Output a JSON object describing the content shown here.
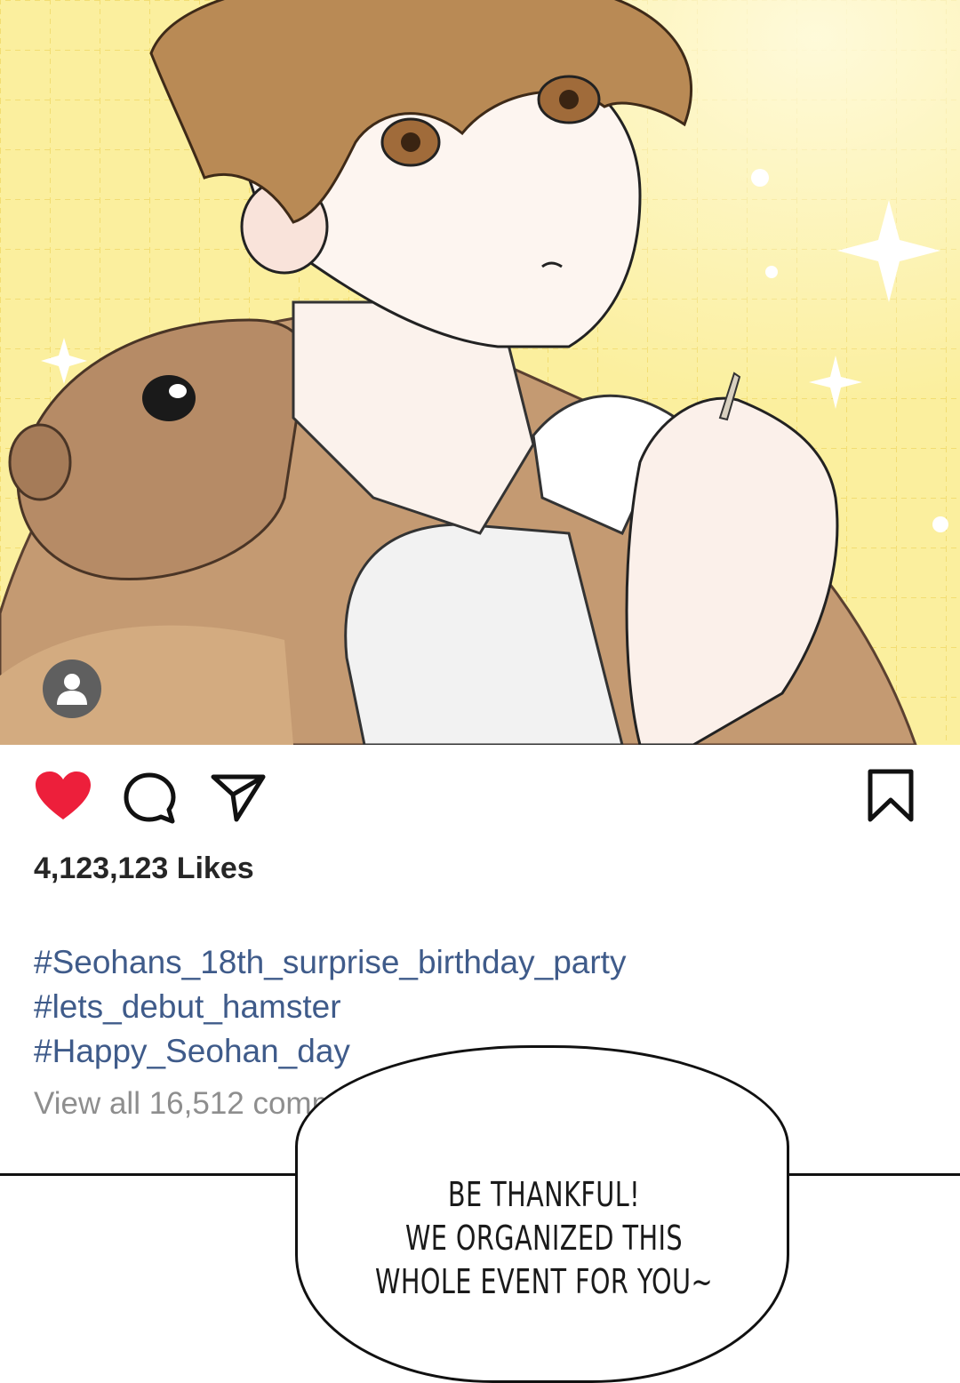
{
  "post": {
    "likes_text": "4,123,123 Likes",
    "hashtags": [
      "#Seohans_18th_surprise_birthday_party",
      "#lets_debut_hamster",
      "#Happy_Seohan_day"
    ],
    "view_comments_text": "View all 16,512 comm"
  },
  "icons": {
    "avatar": "user-avatar-icon",
    "like": "heart-icon",
    "comment": "comment-bubble-icon",
    "share": "paper-plane-icon",
    "save": "bookmark-icon"
  },
  "colors": {
    "heart": "#ed1f3b",
    "hashtag": "#3f5b8a",
    "muted_text": "#8e8e8e",
    "photo_background": "#fbef9e"
  },
  "speech_bubble": {
    "lines": [
      "BE THANKFUL!",
      "WE ORGANIZED THIS",
      "WHOLE EVENT FOR YOU~"
    ]
  }
}
